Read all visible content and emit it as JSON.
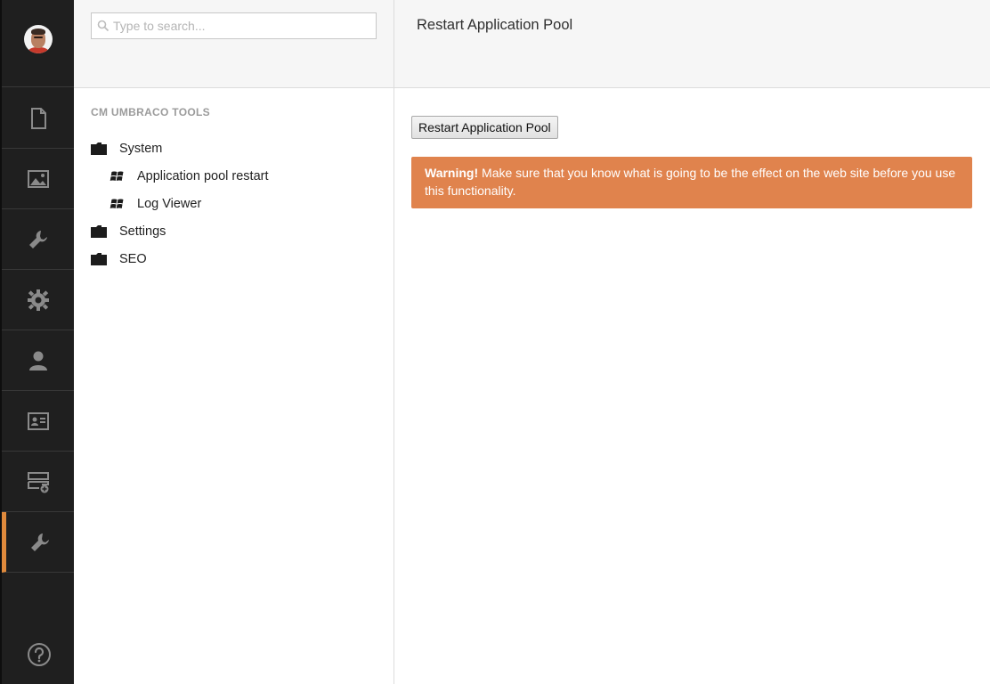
{
  "sidebar": {
    "items": [
      {
        "icon": "document-icon",
        "active": false
      },
      {
        "icon": "image-icon",
        "active": false
      },
      {
        "icon": "wrench-icon",
        "active": false
      },
      {
        "icon": "gear-icon",
        "active": false
      },
      {
        "icon": "user-icon",
        "active": false
      },
      {
        "icon": "id-card-icon",
        "active": false
      },
      {
        "icon": "add-form-icon",
        "active": false
      },
      {
        "icon": "wrench-icon",
        "active": true
      }
    ],
    "help_icon": "question-icon",
    "accent_color": "#e08a3c"
  },
  "search": {
    "placeholder": "Type to search...",
    "value": ""
  },
  "tree": {
    "section_title": "CM UMBRACO TOOLS",
    "nodes": [
      {
        "label": "System",
        "icon": "folder-icon"
      },
      {
        "label": "Application pool restart",
        "icon": "windows-icon"
      },
      {
        "label": "Log Viewer",
        "icon": "windows-icon"
      },
      {
        "label": "Settings",
        "icon": "folder-icon"
      },
      {
        "label": "SEO",
        "icon": "folder-icon"
      }
    ]
  },
  "main": {
    "title": "Restart Application Pool",
    "button_label": "Restart Application Pool",
    "warning_strong": "Warning!",
    "warning_text": " Make sure that you know what is going to be the effect on the web site before you use this functionality.",
    "warning_color": "#e0834d"
  }
}
